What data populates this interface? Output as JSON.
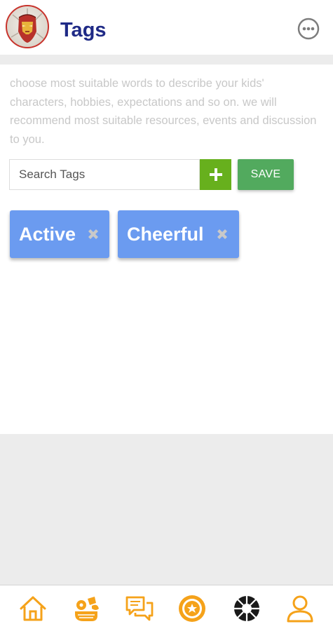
{
  "header": {
    "title": "Tags",
    "avatar_icon": "iron-man-avatar-icon",
    "more_icon": "more-options-icon"
  },
  "description": "choose most suitable words to describe your kids' characters, hobbies, expectations and so on. we will recommend most suitable resources, events and discussion to you.",
  "search": {
    "placeholder": "Search Tags",
    "value": ""
  },
  "buttons": {
    "add_icon": "plus-icon",
    "save_label": "SAVE"
  },
  "tags": [
    {
      "label": "Active",
      "remove_icon": "close-icon"
    },
    {
      "label": "Cheerful",
      "remove_icon": "close-icon"
    }
  ],
  "bottom_nav": {
    "items": [
      {
        "icon": "home-icon"
      },
      {
        "icon": "toys-icon"
      },
      {
        "icon": "chat-icon"
      },
      {
        "icon": "badge-icon"
      },
      {
        "icon": "shutter-icon"
      },
      {
        "icon": "user-icon"
      }
    ]
  },
  "colors": {
    "title": "#1f2a86",
    "add_button": "#67b01d",
    "save_button": "#52aa5e",
    "tag": "#6b9bf0",
    "nav_icon": "#f5a21a",
    "description_text": "#c8c8c8"
  }
}
